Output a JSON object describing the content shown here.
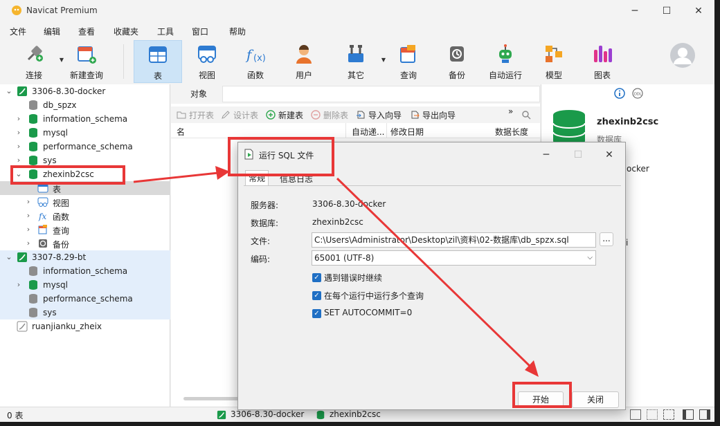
{
  "window": {
    "title": "Navicat Premium"
  },
  "menu": [
    "文件",
    "编辑",
    "查看",
    "收藏夹",
    "工具",
    "窗口",
    "帮助"
  ],
  "toolbar": [
    {
      "label": "连接"
    },
    {
      "label": "新建查询"
    },
    {
      "label": "表"
    },
    {
      "label": "视图"
    },
    {
      "label": "函数"
    },
    {
      "label": "用户"
    },
    {
      "label": "其它"
    },
    {
      "label": "查询"
    },
    {
      "label": "备份"
    },
    {
      "label": "自动运行"
    },
    {
      "label": "模型"
    },
    {
      "label": "图表"
    }
  ],
  "tree": {
    "conn1": "3306-8.30-docker",
    "db1": [
      "db_spzx",
      "information_schema",
      "mysql",
      "performance_schema",
      "sys"
    ],
    "selected_db": "zhexinb2csc",
    "children": [
      "表",
      "视图",
      "函数",
      "查询",
      "备份"
    ],
    "conn2": "3307-8.29-bt",
    "db2": [
      "information_schema",
      "mysql",
      "performance_schema",
      "sys"
    ],
    "conn3": "ruanjianku_zheix"
  },
  "center": {
    "tab": "对象",
    "actions": [
      "打开表",
      "设计表",
      "新建表",
      "删除表",
      "导入向导",
      "导出向导"
    ],
    "columns": [
      "名",
      "自动递...",
      "修改日期",
      "数据长度"
    ]
  },
  "right": {
    "name": "zhexinb2csc",
    "type": "数据库",
    "frag1": "ocker",
    "frag2": "i"
  },
  "status": {
    "count": "0 表",
    "conn": "3306-8.30-docker",
    "db": "zhexinb2csc"
  },
  "dialog": {
    "title": "运行 SQL 文件",
    "tabs": [
      "常规",
      "信息日志"
    ],
    "server_label": "服务器:",
    "server": "3306-8.30-docker",
    "db_label": "数据库:",
    "db": "zhexinb2csc",
    "file_label": "文件:",
    "file": "C:\\Users\\Administrator\\Desktop\\zil\\资料\\02-数据库\\db_spzx.sql",
    "browse": "...",
    "enc_label": "编码:",
    "encoding": "65001 (UTF-8)",
    "options": [
      "遇到错误时继续",
      "在每个运行中运行多个查询",
      "SET AUTOCOMMIT=0"
    ],
    "start": "开始",
    "close": "关闭"
  },
  "colors": {
    "accent": "#1f6fc4",
    "highlight": "#e83737",
    "db_green": "#1a9a4a"
  }
}
